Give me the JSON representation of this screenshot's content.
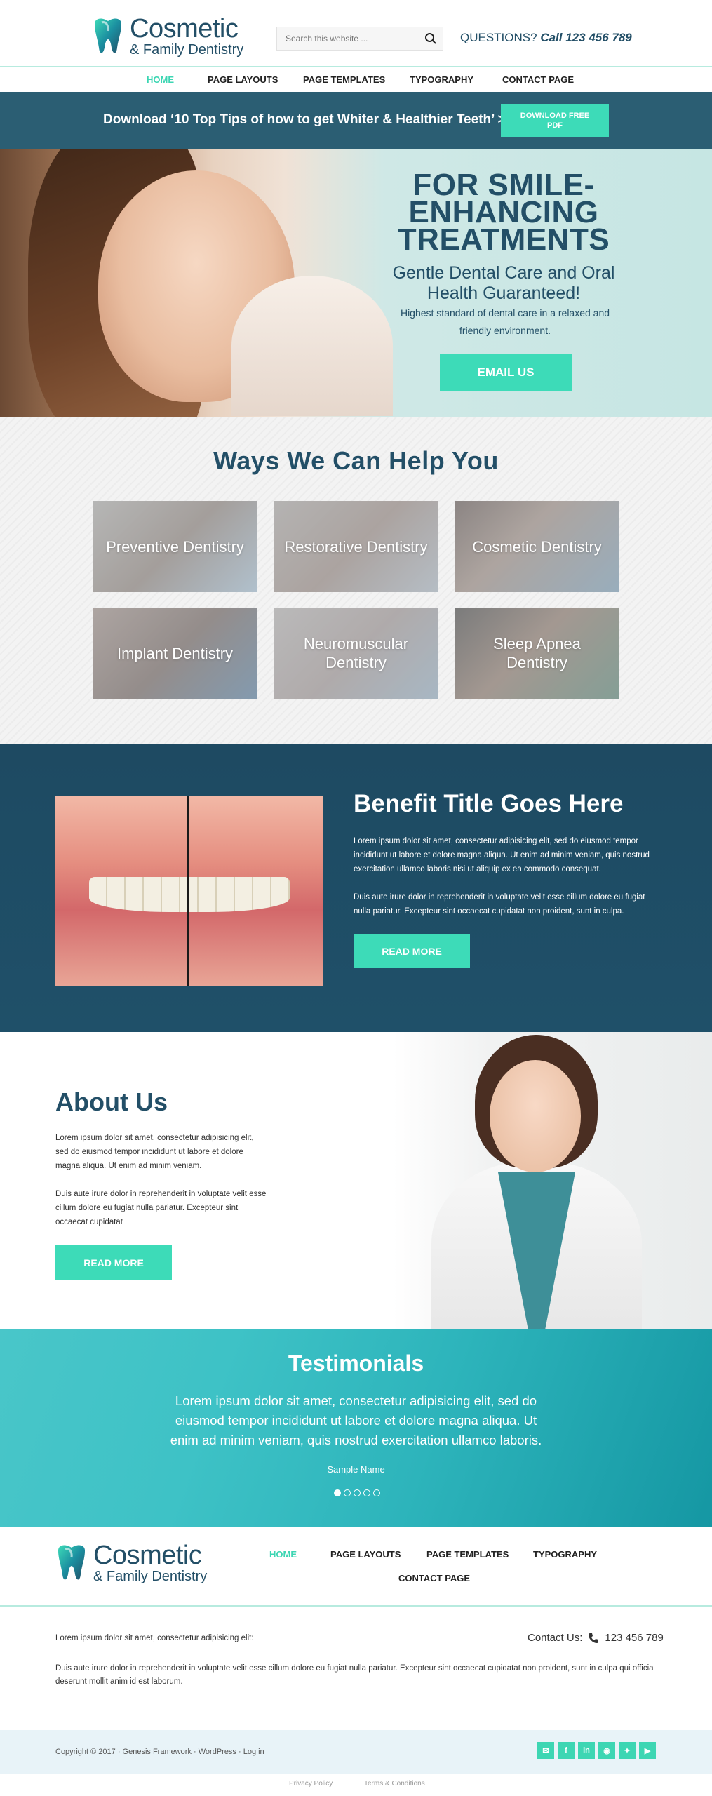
{
  "header": {
    "logo_title": "Cosmetic",
    "logo_subtitle": "& Family Dentistry",
    "search_placeholder": "Search this website ...",
    "questions_label": "QUESTIONS?",
    "questions_phone": "Call 123 456 789"
  },
  "nav": {
    "items": [
      "HOME",
      "PAGE LAYOUTS",
      "PAGE TEMPLATES",
      "TYPOGRAPHY",
      "CONTACT PAGE"
    ],
    "active": "HOME"
  },
  "banner": {
    "text": "Download ‘10 Top Tips of how to get Whiter & Healthier Teeth’ >>>",
    "button": "DOWNLOAD FREE PDF"
  },
  "hero": {
    "title": "FOR SMILE-ENHANCING TREATMENTS",
    "subtitle": "Gentle Dental Care and Oral Health Guaranteed!",
    "description": "Highest standard of dental care in a relaxed and friendly environment.",
    "button": "EMAIL US"
  },
  "services": {
    "title": "Ways We Can Help You",
    "tiles": [
      "Preventive Dentistry",
      "Restorative Dentistry",
      "Cosmetic Dentistry",
      "Implant Dentistry",
      "Neuromuscular Dentistry",
      "Sleep Apnea Dentistry"
    ]
  },
  "benefit": {
    "title": "Benefit Title Goes Here",
    "paragraph1": "Lorem ipsum dolor sit amet, consectetur adipisicing elit, sed do eiusmod tempor incididunt ut labore et dolore magna aliqua. Ut enim ad minim veniam, quis nostrud exercitation ullamco laboris nisi ut aliquip ex ea commodo consequat.",
    "paragraph2": "Duis aute irure dolor in reprehenderit in voluptate velit esse cillum dolore eu fugiat nulla pariatur. Excepteur sint occaecat cupidatat non proident, sunt in culpa.",
    "button": "READ MORE"
  },
  "about": {
    "title": "About Us",
    "paragraph1": "Lorem ipsum dolor sit amet, consectetur adipisicing elit, sed do eiusmod tempor incididunt ut labore et dolore magna aliqua. Ut enim ad minim veniam.",
    "paragraph2": "Duis aute irure dolor in reprehenderit in voluptate velit esse cillum dolore eu fugiat nulla pariatur. Excepteur sint occaecat cupidatat",
    "button": "READ MORE"
  },
  "testimonials": {
    "title": "Testimonials",
    "quote": "Lorem ipsum dolor sit amet, consectetur adipisicing elit, sed do eiusmod tempor incididunt ut labore et dolore magna aliqua. Ut enim ad minim veniam, quis nostrud exercitation ullamco laboris.",
    "name": "Sample Name",
    "slide_count": 5,
    "active_slide": 1
  },
  "footer": {
    "logo_title": "Cosmetic",
    "logo_subtitle": "& Family Dentistry",
    "nav": [
      "HOME",
      "PAGE LAYOUTS",
      "PAGE TEMPLATES",
      "TYPOGRAPHY",
      "CONTACT PAGE"
    ],
    "tagline": "Lorem ipsum dolor sit amet, consectetur adipisicing elit:",
    "contact_label": "Contact Us:",
    "contact_phone": "123 456 789",
    "body": "Duis aute irure dolor in reprehenderit in voluptate velit esse cillum dolore eu fugiat nulla pariatur. Excepteur sint occaecat cupidatat non proident, sunt in culpa qui officia deserunt mollit anim id est laborum.",
    "copyright": "Copyright © 2017 · Genesis Framework · WordPress · Log in",
    "social_icons": [
      "email-icon",
      "facebook-icon",
      "linkedin-icon",
      "rss-icon",
      "twitter-icon",
      "youtube-icon"
    ],
    "privacy": "Privacy Policy",
    "terms": "Terms & Conditions"
  },
  "colors": {
    "navy": "#234f67",
    "teal": "#3ddbb8",
    "banner_bg": "#2b5e73",
    "benefit_bg": "#1f4e66",
    "testimonial_bg": "#2db4bb"
  }
}
